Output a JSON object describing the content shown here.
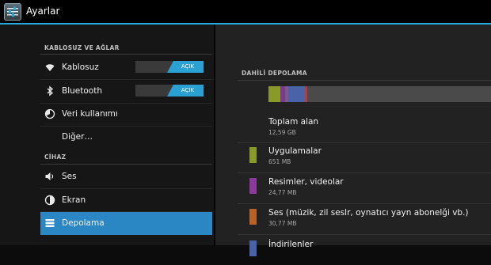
{
  "app": {
    "title": "Ayarlar",
    "icon": "settings-sliders-icon"
  },
  "sidebar": {
    "sections": [
      {
        "header": "KABLOSUZ VE AĞLAR"
      },
      {
        "header": "CİHAZ"
      }
    ],
    "items": [
      {
        "label": "Kablosuz",
        "icon": "wifi-icon",
        "toggle": "AÇIK"
      },
      {
        "label": "Bluetooth",
        "icon": "bluetooth-icon",
        "toggle": "AÇIK"
      },
      {
        "label": "Veri kullanımı",
        "icon": "data-usage-icon"
      },
      {
        "label": "Diğer…"
      },
      {
        "label": "Ses",
        "icon": "speaker-icon"
      },
      {
        "label": "Ekran",
        "icon": "brightness-icon"
      },
      {
        "label": "Depolama",
        "icon": "storage-list-icon",
        "selected": true
      }
    ]
  },
  "storage": {
    "header": "DAHİLİ DEPOLAMA",
    "usage_bar": {
      "segments": [
        {
          "color": "#8a9a28",
          "fraction": 0.055
        },
        {
          "color": "#7a3a8c",
          "fraction": 0.02
        },
        {
          "color": "#7a5a8c",
          "fraction": 0.015
        },
        {
          "color": "#4a62a8",
          "fraction": 0.075
        },
        {
          "color": "#b83a3a",
          "fraction": 0.008
        }
      ],
      "free_color": "#4a4a4a"
    },
    "items": [
      {
        "name": "Toplam alan",
        "size": "12,59 GB"
      },
      {
        "name": "Uygulamalar",
        "size": "651 MB",
        "color": "#8a9a28"
      },
      {
        "name": "Resimler, videolar",
        "size": "24,77 MB",
        "color": "#8a3a9a"
      },
      {
        "name": "Ses (müzik, zil seslr, oynatıcı yayn abonelği vb.)",
        "size": "30,77 MB",
        "color": "#b8622a"
      },
      {
        "name": "İndirilenler",
        "color": "#4a62a8"
      }
    ]
  }
}
